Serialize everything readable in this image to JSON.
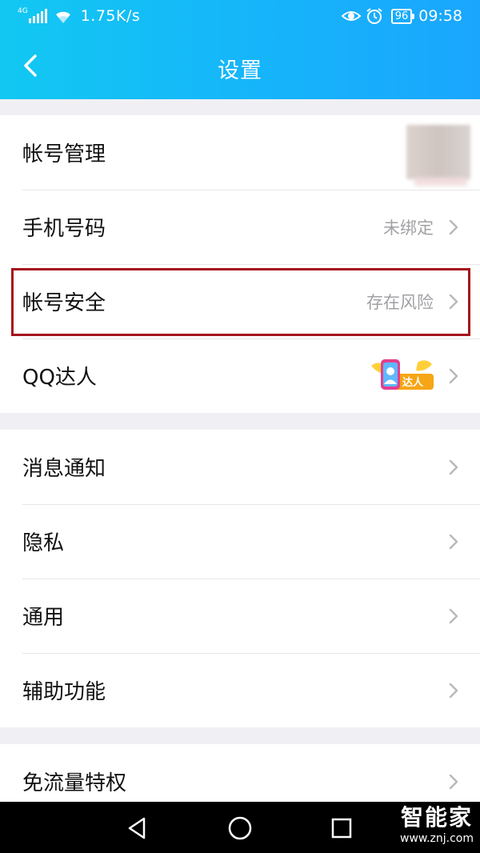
{
  "status_bar": {
    "network": "4G",
    "speed": "1.75K/s",
    "battery": "96",
    "time": "09:58",
    "icons": [
      "signal-icon",
      "wifi-icon",
      "eye-icon",
      "alarm-icon",
      "battery-icon"
    ]
  },
  "header": {
    "title": "设置",
    "back_icon": "chevron-left-icon",
    "gradient": [
      "#12c8f2",
      "#1aa6fd"
    ]
  },
  "groups": [
    {
      "items": [
        {
          "label": "帐号管理",
          "value": "",
          "accessory": "avatar"
        },
        {
          "label": "手机号码",
          "value": "未绑定",
          "accessory": "chevron"
        },
        {
          "label": "帐号安全",
          "value": "存在风险",
          "accessory": "chevron",
          "highlighted": true
        },
        {
          "label": "QQ达人",
          "value": "",
          "badge_text": "达人",
          "accessory": "chevron"
        }
      ]
    },
    {
      "items": [
        {
          "label": "消息通知",
          "value": "",
          "accessory": "chevron"
        },
        {
          "label": "隐私",
          "value": "",
          "accessory": "chevron"
        },
        {
          "label": "通用",
          "value": "",
          "accessory": "chevron"
        },
        {
          "label": "辅助功能",
          "value": "",
          "accessory": "chevron"
        }
      ]
    },
    {
      "items": [
        {
          "label": "免流量特权",
          "value": "",
          "accessory": "chevron"
        }
      ]
    }
  ],
  "highlight_color": "#a5111b",
  "system_nav": {
    "buttons": [
      "back-triangle-icon",
      "home-circle-icon",
      "recents-square-icon"
    ]
  },
  "watermark": {
    "brand": "智能家",
    "url": "www.znj.com"
  }
}
